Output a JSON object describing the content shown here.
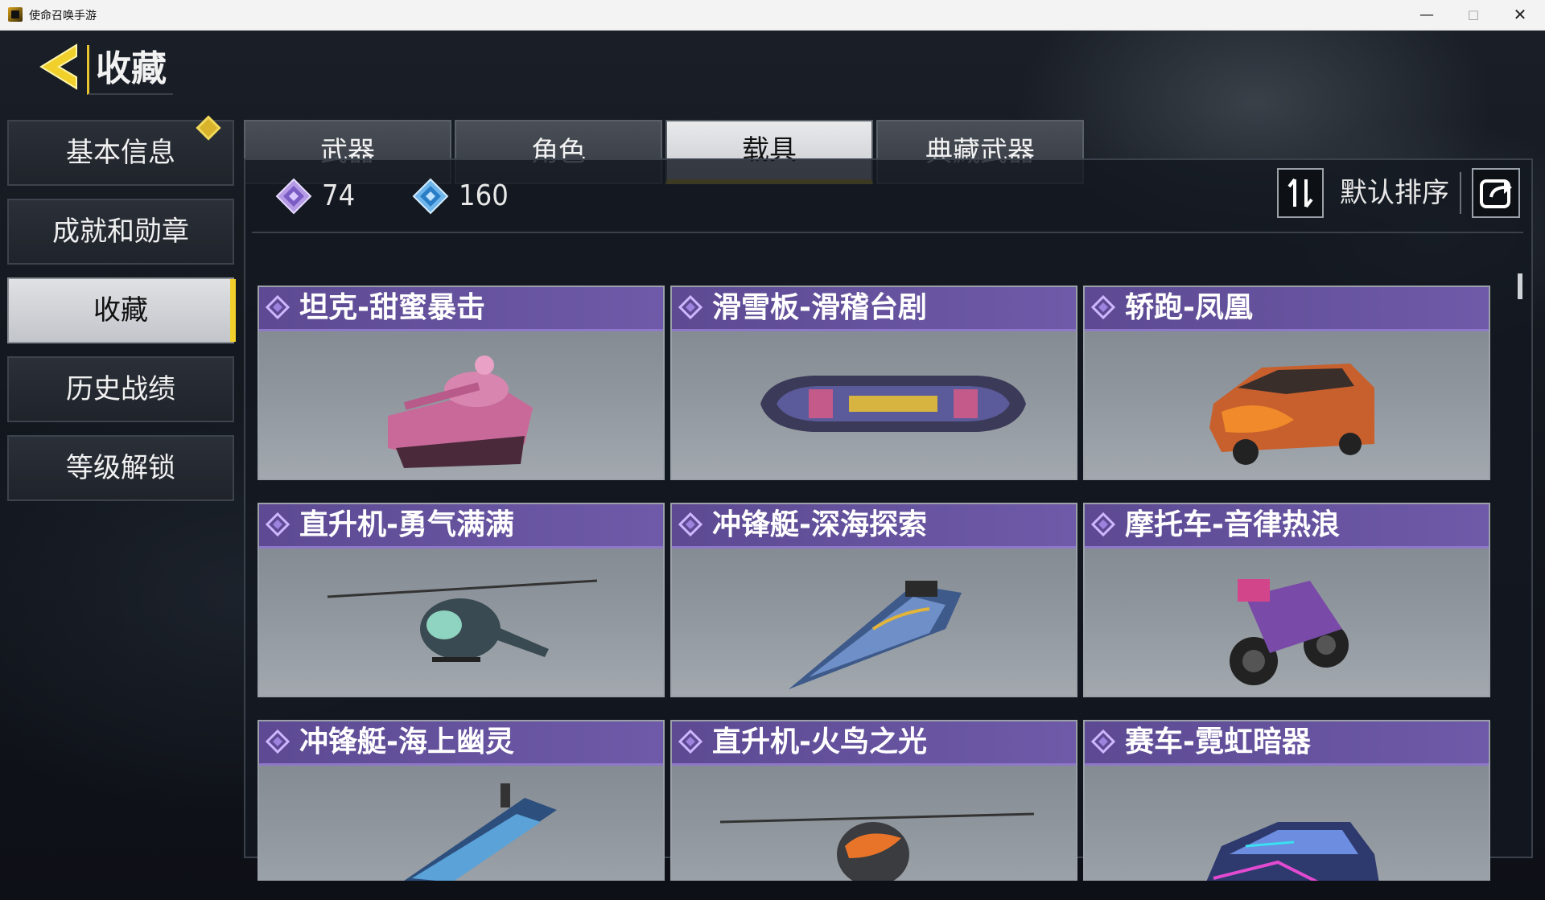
{
  "window": {
    "title": "使命召唤手游",
    "minimize_label": "—",
    "maximize_label": "□",
    "close_label": "✕"
  },
  "header": {
    "title": "收藏",
    "back_icon": "back-arrow-icon"
  },
  "sidebar": {
    "items": [
      {
        "label": "基本信息",
        "has_badge": true
      },
      {
        "label": "成就和勋章"
      },
      {
        "label": "收藏",
        "active": true
      },
      {
        "label": "历史战绩"
      },
      {
        "label": "等级解锁"
      }
    ]
  },
  "tabs": [
    {
      "label": "武器"
    },
    {
      "label": "角色"
    },
    {
      "label": "载具",
      "active": true
    },
    {
      "label": "典藏武器"
    }
  ],
  "stats": {
    "purple_count": "74",
    "blue_count": "160"
  },
  "sort": {
    "label": "默认排序",
    "sort_icon": "sort-arrows-icon",
    "share_icon": "share-icon"
  },
  "colors": {
    "accent_yellow": "#f1d02c",
    "card_header_purple": "#6e5aa8",
    "panel_bg": "#141921"
  },
  "cards": [
    {
      "name": "坦克-甜蜜暴击",
      "art": "tank"
    },
    {
      "name": "滑雪板-滑稽台剧",
      "art": "snowboard"
    },
    {
      "name": "轿跑-凤凰",
      "art": "car"
    },
    {
      "name": "直升机-勇气满满",
      "art": "helicopter"
    },
    {
      "name": "冲锋艇-深海探索",
      "art": "boat"
    },
    {
      "name": "摩托车-音律热浪",
      "art": "motorcycle"
    },
    {
      "name": "冲锋艇-海上幽灵",
      "art": "boat2"
    },
    {
      "name": "直升机-火鸟之光",
      "art": "helicopter2"
    },
    {
      "name": "赛车-霓虹暗器",
      "art": "racecar"
    }
  ]
}
